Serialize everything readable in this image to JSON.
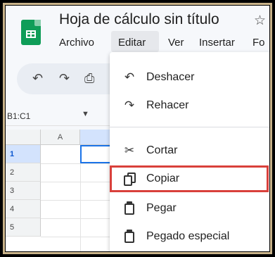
{
  "header": {
    "title": "Hoja de cálculo sin título",
    "star_icon": "star-icon"
  },
  "menu": {
    "archivo": "Archivo",
    "editar": "Editar",
    "ver": "Ver",
    "insertar": "Insertar",
    "formato": "Fo"
  },
  "toolbar": {
    "undo_icon": "undo-icon",
    "redo_icon": "redo-icon",
    "print_icon": "print-icon"
  },
  "namebox": {
    "value": "B1:C1"
  },
  "columns": [
    "A"
  ],
  "rows": [
    "1",
    "2",
    "3",
    "4",
    "5"
  ],
  "edit_menu": {
    "items": [
      {
        "label": "Deshacer",
        "icon": "undo-icon"
      },
      {
        "label": "Rehacer",
        "icon": "redo-icon"
      },
      {
        "label": "Cortar",
        "icon": "scissors-icon"
      },
      {
        "label": "Copiar",
        "icon": "copy-icon"
      },
      {
        "label": "Pegar",
        "icon": "clipboard-icon"
      },
      {
        "label": "Pegado especial",
        "icon": "clipboard-icon"
      }
    ]
  },
  "colors": {
    "accent": "#1a73e8",
    "highlight": "#d9403b",
    "logo": "#0f9d58"
  }
}
